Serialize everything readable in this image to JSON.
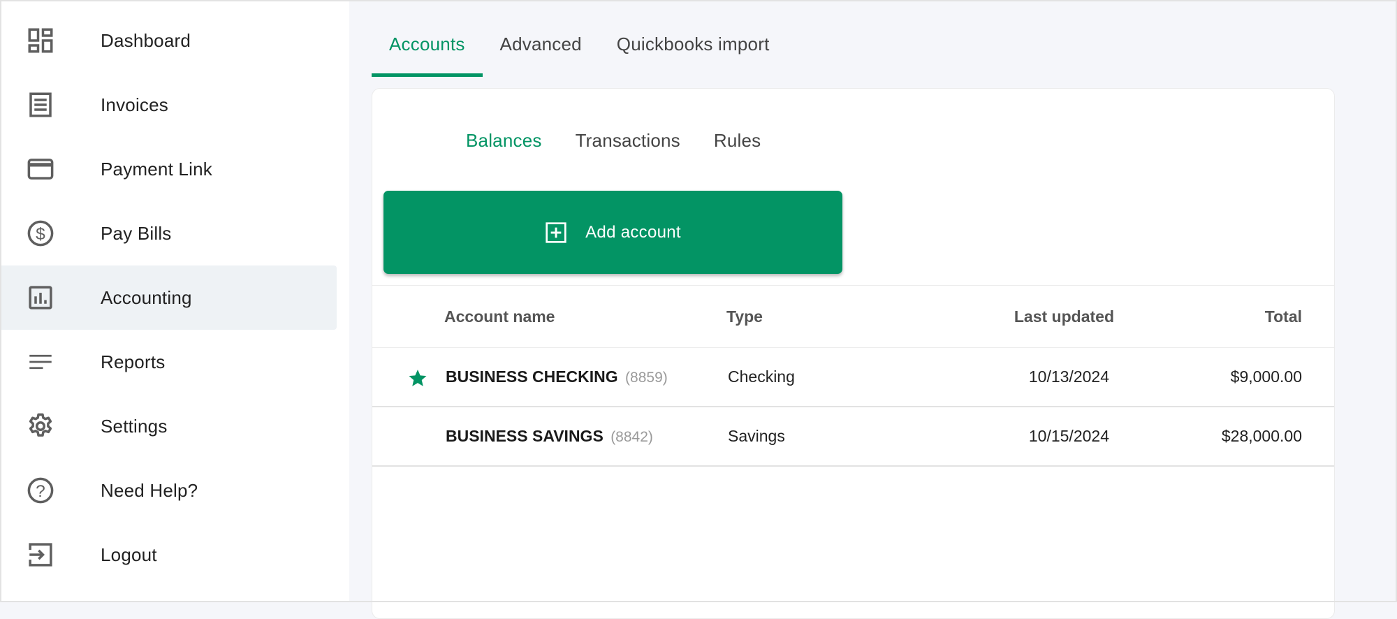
{
  "sidebar": {
    "items": [
      {
        "label": "Dashboard",
        "icon": "dashboard-icon",
        "active": false
      },
      {
        "label": "Invoices",
        "icon": "receipt-icon",
        "active": false
      },
      {
        "label": "Payment Link",
        "icon": "credit-card-icon",
        "active": false
      },
      {
        "label": "Pay Bills",
        "icon": "dollar-circle-icon",
        "active": false
      },
      {
        "label": "Accounting",
        "icon": "bar-chart-icon",
        "active": true
      },
      {
        "label": "Reports",
        "icon": "lines-icon",
        "active": false
      },
      {
        "label": "Settings",
        "icon": "gear-icon",
        "active": false
      },
      {
        "label": "Need Help?",
        "icon": "help-circle-icon",
        "active": false
      },
      {
        "label": "Logout",
        "icon": "logout-icon",
        "active": false
      }
    ]
  },
  "top_tabs": [
    {
      "label": "Accounts",
      "active": true
    },
    {
      "label": "Advanced",
      "active": false
    },
    {
      "label": "Quickbooks import",
      "active": false
    }
  ],
  "sub_tabs": [
    {
      "label": "Balances",
      "active": true
    },
    {
      "label": "Transactions",
      "active": false
    },
    {
      "label": "Rules",
      "active": false
    }
  ],
  "add_account": {
    "label": "Add account",
    "icon": "plus-square-icon"
  },
  "table": {
    "headers": {
      "name": "Account name",
      "type": "Type",
      "last_updated": "Last updated",
      "total": "Total"
    },
    "rows": [
      {
        "name": "BUSINESS CHECKING",
        "number": "(8859)",
        "type": "Checking",
        "last_updated": "10/13/2024",
        "total": "$9,000.00",
        "starred": true
      },
      {
        "name": "BUSINESS SAVINGS",
        "number": "(8842)",
        "type": "Savings",
        "last_updated": "10/15/2024",
        "total": "$28,000.00",
        "starred": false
      }
    ]
  },
  "colors": {
    "accent": "#039464",
    "sidebar_active_bg": "#eef2f5",
    "page_bg": "#f5f6fa",
    "icon_gray": "#5f5f5f"
  }
}
